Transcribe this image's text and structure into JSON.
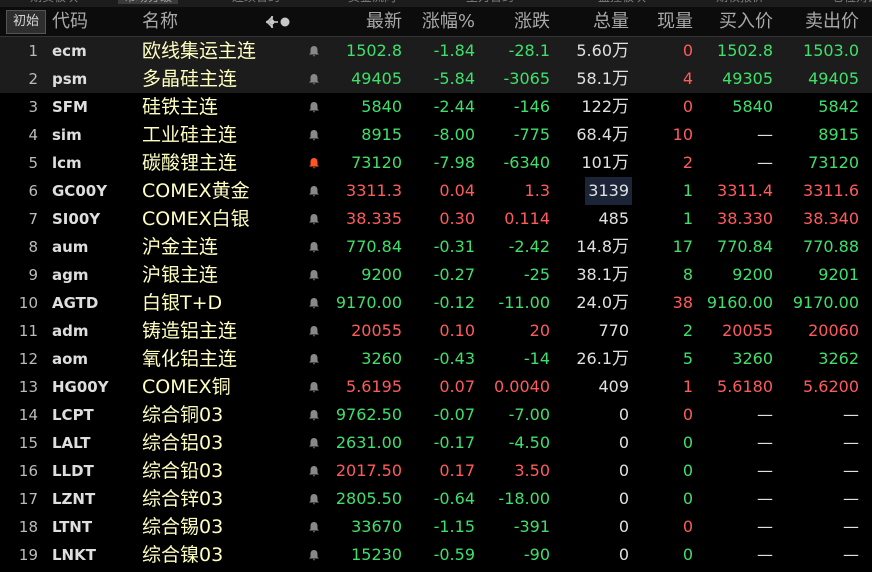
{
  "top_tabs": [
    "期货板块",
    "市场分级",
    "连续合约",
    "资金流向",
    "主力合约",
    "监控板块",
    "期权报价",
    "仓位对比"
  ],
  "header": {
    "init_label": "初始",
    "col_code": "代码",
    "col_name": "名称",
    "col_latest": "最新",
    "col_pct": "涨幅%",
    "col_change": "涨跌",
    "col_volume": "总量",
    "col_current": "现量",
    "col_bid": "买入价",
    "col_ask": "卖出价"
  },
  "colors": {
    "up": "#ff5b5b",
    "down": "#3fe06a",
    "name": "#ffffc0",
    "bell_alert": "#ff5522",
    "bell": "#888888"
  },
  "rows": [
    {
      "idx": "1",
      "code": "ecm",
      "name": "欧线集运主连",
      "latest": "1502.8",
      "pct": "-1.84",
      "chg": "-28.1",
      "vol": "5.60",
      "unit": "万",
      "cur": "0",
      "bid": "1502.8",
      "ask": "1503.0",
      "trend": "down",
      "cur_trend": "up",
      "highlight": true,
      "alert": false
    },
    {
      "idx": "2",
      "code": "psm",
      "name": "多晶硅主连",
      "latest": "49405",
      "pct": "-5.84",
      "chg": "-3065",
      "vol": "58.1",
      "unit": "万",
      "cur": "4",
      "bid": "49305",
      "ask": "49405",
      "trend": "down",
      "cur_trend": "up",
      "highlight": true,
      "alert": false
    },
    {
      "idx": "3",
      "code": "SFM",
      "name": "硅铁主连",
      "latest": "5840",
      "pct": "-2.44",
      "chg": "-146",
      "vol": "122",
      "unit": "万",
      "cur": "0",
      "bid": "5840",
      "ask": "5842",
      "trend": "down",
      "cur_trend": "up",
      "highlight": false,
      "alert": false
    },
    {
      "idx": "4",
      "code": "sim",
      "name": "工业硅主连",
      "latest": "8915",
      "pct": "-8.00",
      "chg": "-775",
      "vol": "68.4",
      "unit": "万",
      "cur": "10",
      "bid": "—",
      "ask": "8915",
      "trend": "down",
      "cur_trend": "up",
      "highlight": false,
      "alert": false
    },
    {
      "idx": "5",
      "code": "lcm",
      "name": "碳酸锂主连",
      "latest": "73120",
      "pct": "-7.98",
      "chg": "-6340",
      "vol": "101",
      "unit": "万",
      "cur": "2",
      "bid": "—",
      "ask": "73120",
      "trend": "down",
      "cur_trend": "up",
      "highlight": false,
      "alert": true
    },
    {
      "idx": "6",
      "code": "GC00Y",
      "name": "COMEX黄金",
      "latest": "3311.3",
      "pct": "0.04",
      "chg": "1.3",
      "vol": "3139",
      "unit": "",
      "cur": "1",
      "bid": "3311.4",
      "ask": "3311.6",
      "trend": "up",
      "cur_trend": "down",
      "highlight": false,
      "alert": false,
      "vol_box": true
    },
    {
      "idx": "7",
      "code": "SI00Y",
      "name": "COMEX白银",
      "latest": "38.335",
      "pct": "0.30",
      "chg": "0.114",
      "vol": "485",
      "unit": "",
      "cur": "1",
      "bid": "38.330",
      "ask": "38.340",
      "trend": "up",
      "cur_trend": "down",
      "highlight": false,
      "alert": false
    },
    {
      "idx": "8",
      "code": "aum",
      "name": "沪金主连",
      "latest": "770.84",
      "pct": "-0.31",
      "chg": "-2.42",
      "vol": "14.8",
      "unit": "万",
      "cur": "17",
      "bid": "770.84",
      "ask": "770.88",
      "trend": "down",
      "cur_trend": "down",
      "highlight": false,
      "alert": false
    },
    {
      "idx": "9",
      "code": "agm",
      "name": "沪银主连",
      "latest": "9200",
      "pct": "-0.27",
      "chg": "-25",
      "vol": "38.1",
      "unit": "万",
      "cur": "8",
      "bid": "9200",
      "ask": "9201",
      "trend": "down",
      "cur_trend": "down",
      "highlight": false,
      "alert": false
    },
    {
      "idx": "10",
      "code": "AGTD",
      "name": "白银T+D",
      "latest": "9170.00",
      "pct": "-0.12",
      "chg": "-11.00",
      "vol": "24.0",
      "unit": "万",
      "cur": "38",
      "bid": "9160.00",
      "ask": "9170.00",
      "trend": "down",
      "cur_trend": "up",
      "highlight": false,
      "alert": false
    },
    {
      "idx": "11",
      "code": "adm",
      "name": "铸造铝主连",
      "latest": "20055",
      "pct": "0.10",
      "chg": "20",
      "vol": "770",
      "unit": "",
      "cur": "2",
      "bid": "20055",
      "ask": "20060",
      "trend": "up",
      "cur_trend": "down",
      "highlight": false,
      "alert": false
    },
    {
      "idx": "12",
      "code": "aom",
      "name": "氧化铝主连",
      "latest": "3260",
      "pct": "-0.43",
      "chg": "-14",
      "vol": "26.1",
      "unit": "万",
      "cur": "5",
      "bid": "3260",
      "ask": "3262",
      "trend": "down",
      "cur_trend": "down",
      "highlight": false,
      "alert": false
    },
    {
      "idx": "13",
      "code": "HG00Y",
      "name": "COMEX铜",
      "latest": "5.6195",
      "pct": "0.07",
      "chg": "0.0040",
      "vol": "409",
      "unit": "",
      "cur": "1",
      "bid": "5.6180",
      "ask": "5.6200",
      "trend": "up",
      "cur_trend": "up",
      "highlight": false,
      "alert": false
    },
    {
      "idx": "14",
      "code": "LCPT",
      "name": "综合铜03",
      "latest": "9762.50",
      "pct": "-0.07",
      "chg": "-7.00",
      "vol": "0",
      "unit": "",
      "cur": "0",
      "bid": "—",
      "ask": "—",
      "trend": "down",
      "cur_trend": "up",
      "highlight": false,
      "alert": false
    },
    {
      "idx": "15",
      "code": "LALT",
      "name": "综合铝03",
      "latest": "2631.00",
      "pct": "-0.17",
      "chg": "-4.50",
      "vol": "0",
      "unit": "",
      "cur": "0",
      "bid": "—",
      "ask": "—",
      "trend": "down",
      "cur_trend": "down",
      "highlight": false,
      "alert": false
    },
    {
      "idx": "16",
      "code": "LLDT",
      "name": "综合铅03",
      "latest": "2017.50",
      "pct": "0.17",
      "chg": "3.50",
      "vol": "0",
      "unit": "",
      "cur": "0",
      "bid": "—",
      "ask": "—",
      "trend": "up",
      "cur_trend": "down",
      "highlight": false,
      "alert": false
    },
    {
      "idx": "17",
      "code": "LZNT",
      "name": "综合锌03",
      "latest": "2805.50",
      "pct": "-0.64",
      "chg": "-18.00",
      "vol": "0",
      "unit": "",
      "cur": "0",
      "bid": "—",
      "ask": "—",
      "trend": "down",
      "cur_trend": "down",
      "highlight": false,
      "alert": false
    },
    {
      "idx": "18",
      "code": "LTNT",
      "name": "综合锡03",
      "latest": "33670",
      "pct": "-1.15",
      "chg": "-391",
      "vol": "0",
      "unit": "",
      "cur": "0",
      "bid": "—",
      "ask": "—",
      "trend": "down",
      "cur_trend": "up",
      "highlight": false,
      "alert": false
    },
    {
      "idx": "19",
      "code": "LNKT",
      "name": "综合镍03",
      "latest": "15230",
      "pct": "-0.59",
      "chg": "-90",
      "vol": "0",
      "unit": "",
      "cur": "0",
      "bid": "—",
      "ask": "—",
      "trend": "down",
      "cur_trend": "down",
      "highlight": false,
      "alert": false
    }
  ]
}
